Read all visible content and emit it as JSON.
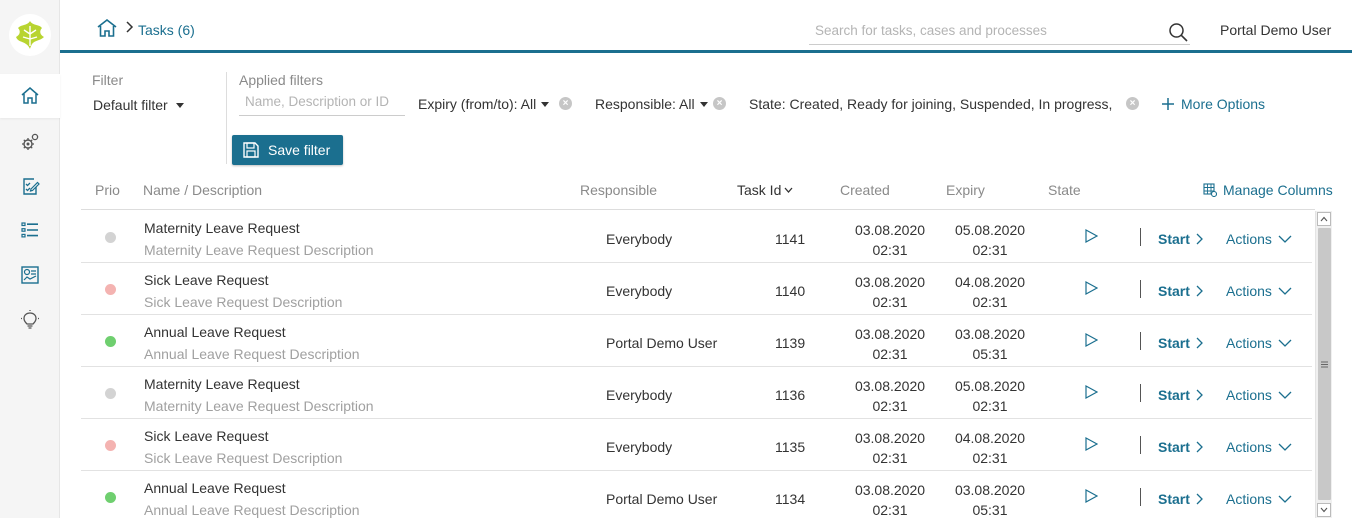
{
  "header": {
    "breadcrumb_current": "Tasks (6)",
    "search_placeholder": "Search for tasks, cases and processes",
    "user_name": "Portal Demo User"
  },
  "sidebar": {
    "items": [
      {
        "icon": "home-icon",
        "active": true
      },
      {
        "icon": "gears-icon",
        "active": false
      },
      {
        "icon": "task-edit-icon",
        "active": false
      },
      {
        "icon": "list-icon",
        "active": false
      },
      {
        "icon": "dashboard-icon",
        "active": false
      },
      {
        "icon": "lightbulb-icon",
        "active": false
      }
    ]
  },
  "filter": {
    "label": "Filter",
    "selected": "Default filter",
    "applied_label": "Applied filters",
    "name_placeholder": "Name, Description or ID",
    "expiry_chip": "Expiry (from/to): All",
    "responsible_chip": "Responsible: All",
    "state_chip": "State: Created, Ready for joining, Suspended, In progress,",
    "more_options": "More Options",
    "save_filter": "Save filter"
  },
  "table": {
    "columns": {
      "prio": "Prio",
      "name": "Name / Description",
      "responsible": "Responsible",
      "task_id": "Task Id",
      "created": "Created",
      "expiry": "Expiry",
      "state": "State"
    },
    "manage_columns": "Manage Columns",
    "start_label": "Start",
    "actions_label": "Actions",
    "rows": [
      {
        "prio_color": "#d3d3d3",
        "name": "Maternity Leave Request",
        "description": "Maternity Leave Request Description",
        "responsible": "Everybody",
        "id": "1141",
        "created_date": "03.08.2020",
        "created_time": "02:31",
        "expiry_date": "05.08.2020",
        "expiry_time": "02:31"
      },
      {
        "prio_color": "#f4b3b1",
        "name": "Sick Leave Request",
        "description": "Sick Leave Request Description",
        "responsible": "Everybody",
        "id": "1140",
        "created_date": "03.08.2020",
        "created_time": "02:31",
        "expiry_date": "04.08.2020",
        "expiry_time": "02:31"
      },
      {
        "prio_color": "#6fcf6f",
        "name": "Annual Leave Request",
        "description": "Annual Leave Request Description",
        "responsible": "Portal Demo User",
        "id": "1139",
        "created_date": "03.08.2020",
        "created_time": "02:31",
        "expiry_date": "03.08.2020",
        "expiry_time": "05:31"
      },
      {
        "prio_color": "#d3d3d3",
        "name": "Maternity Leave Request",
        "description": "Maternity Leave Request Description",
        "responsible": "Everybody",
        "id": "1136",
        "created_date": "03.08.2020",
        "created_time": "02:31",
        "expiry_date": "05.08.2020",
        "expiry_time": "02:31"
      },
      {
        "prio_color": "#f4b3b1",
        "name": "Sick Leave Request",
        "description": "Sick Leave Request Description",
        "responsible": "Everybody",
        "id": "1135",
        "created_date": "03.08.2020",
        "created_time": "02:31",
        "expiry_date": "04.08.2020",
        "expiry_time": "02:31"
      },
      {
        "prio_color": "#6fcf6f",
        "name": "Annual Leave Request",
        "description": "Annual Leave Request Description",
        "responsible": "Portal Demo User",
        "id": "1134",
        "created_date": "03.08.2020",
        "created_time": "02:31",
        "expiry_date": "03.08.2020",
        "expiry_time": "05:31"
      }
    ]
  },
  "colors": {
    "accent": "#1b6f8f",
    "sidebar_bg": "#f5f5f5",
    "muted_text": "#8a8a8a"
  }
}
